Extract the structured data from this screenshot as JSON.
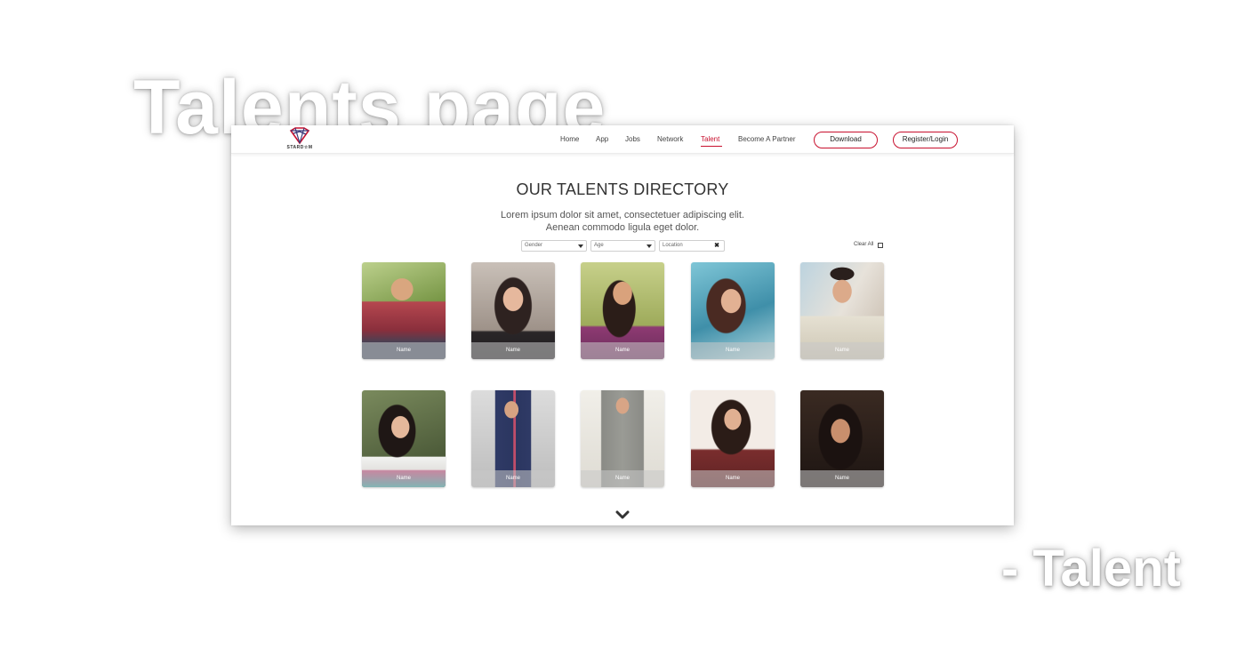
{
  "overlay": {
    "title": "Talents page",
    "subtitle": "- Talent"
  },
  "brand": {
    "logo_text": "STARD☆M"
  },
  "nav": {
    "items": [
      {
        "label": "Home"
      },
      {
        "label": "App"
      },
      {
        "label": "Jobs"
      },
      {
        "label": "Network"
      },
      {
        "label": "Talent",
        "active": true
      },
      {
        "label": "Become A Partner"
      }
    ],
    "download_label": "Download",
    "register_label": "Register/Login",
    "accent_color": "#c8102e"
  },
  "hero": {
    "heading": "OUR TALENTS DIRECTORY",
    "intro_line1": "Lorem ipsum dolor sit amet, consectetuer adipiscing elit.",
    "intro_line2": "Aenean commodo ligula eget dolor."
  },
  "filters": {
    "gender": "Gender",
    "age": "Age",
    "location": "Location",
    "clear_all": "Clear All"
  },
  "talents": [
    {
      "name": "Name"
    },
    {
      "name": "Name"
    },
    {
      "name": "Name"
    },
    {
      "name": "Name"
    },
    {
      "name": "Name"
    },
    {
      "name": "Name"
    },
    {
      "name": "Name"
    },
    {
      "name": "Name"
    },
    {
      "name": "Name"
    },
    {
      "name": "Name"
    }
  ],
  "scroll_icon": "chevron-down-icon"
}
